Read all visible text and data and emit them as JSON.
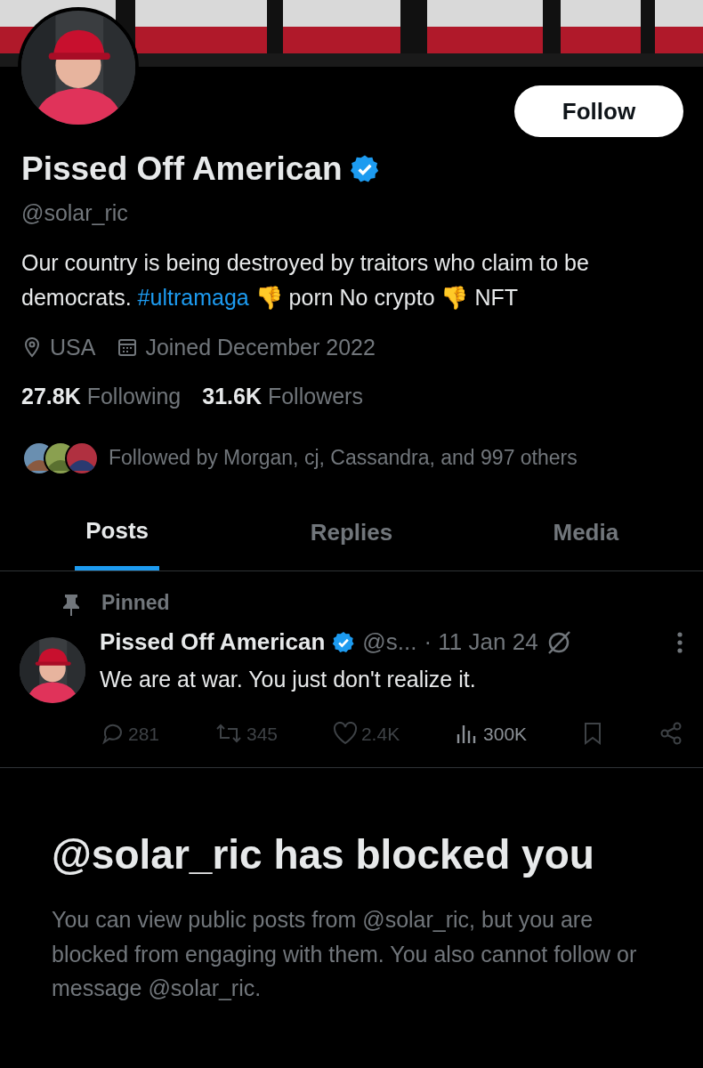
{
  "profile": {
    "name": "Pissed Off American",
    "verified": true,
    "handle": "@solar_ric",
    "follow_button": "Follow",
    "bio": [
      {
        "kind": "text",
        "text": "Our country is being destroyed by traitors who claim to be democrats. "
      },
      {
        "kind": "hashtag",
        "text": "#ultramaga"
      },
      {
        "kind": "text",
        "text": " 👎 porn No crypto 👎 NFT"
      }
    ],
    "meta": [
      {
        "kind": "location",
        "text": "USA"
      },
      {
        "kind": "joined",
        "text": "Joined December 2022"
      }
    ],
    "stats": [
      {
        "count": "27.8K",
        "label": "Following"
      },
      {
        "count": "31.6K",
        "label": "Followers"
      }
    ],
    "followed_by": "Followed by Morgan, cj, Cassandra, and 997 others"
  },
  "tabs": [
    {
      "label": "Posts",
      "selected": true
    },
    {
      "label": "Replies",
      "selected": false
    },
    {
      "label": "Media",
      "selected": false
    }
  ],
  "pinned_post": {
    "pinned_label": "Pinned",
    "author": "Pissed Off American",
    "verified": true,
    "handle": "@s...",
    "date": "· 11 Jan 24",
    "text": "We are at war. You just don't realize it.",
    "actions": [
      {
        "kind": "reply",
        "count": "281"
      },
      {
        "kind": "repost",
        "count": "345"
      },
      {
        "kind": "like",
        "count": "2.4K"
      },
      {
        "kind": "views",
        "count": "300K"
      },
      {
        "kind": "bookmark"
      },
      {
        "kind": "share"
      }
    ]
  },
  "blocked": {
    "title": "@solar_ric has blocked you",
    "message": "You can view public posts from @solar_ric, but you are blocked from engaging with them. You also cannot follow or message @solar_ric."
  }
}
